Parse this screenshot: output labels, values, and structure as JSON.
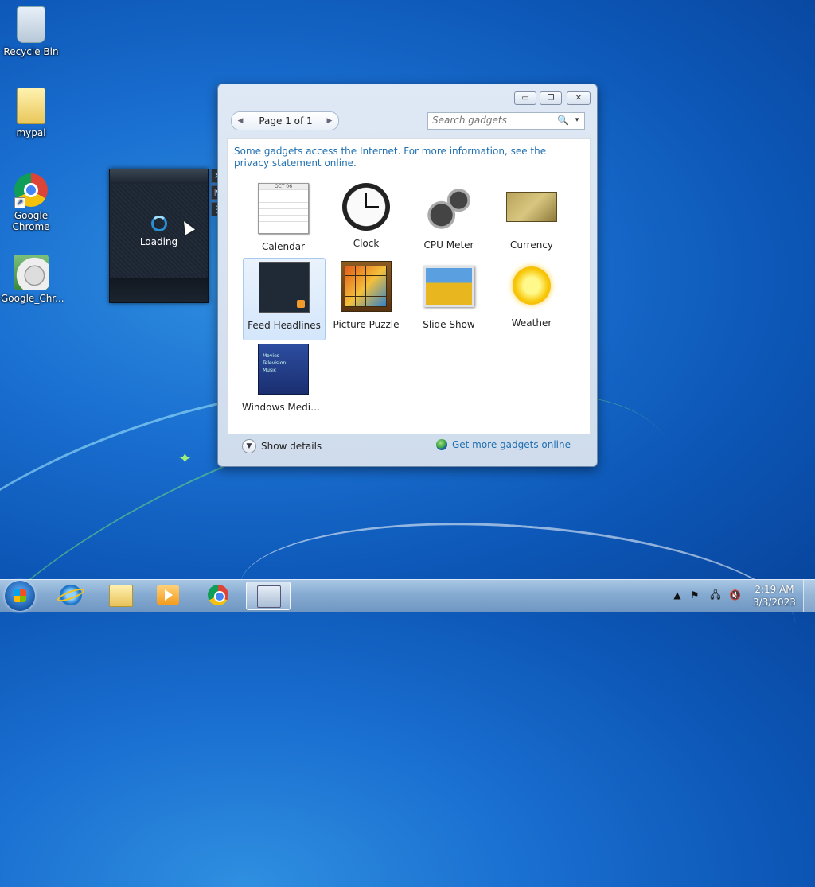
{
  "desktop": {
    "icons": [
      {
        "label": "Recycle Bin",
        "icon": "recycle-bin-icon"
      },
      {
        "label": "mypal",
        "icon": "folder-icon"
      },
      {
        "label": "Google Chrome",
        "icon": "chrome-icon"
      },
      {
        "label": "Google_Chr...",
        "icon": "installer-icon"
      }
    ]
  },
  "loading_gadget": {
    "text": "Loading",
    "tools": {
      "close": "✕",
      "resize": "⇱",
      "drag": "⋮⋮"
    }
  },
  "gallery": {
    "window_buttons": {
      "minimize": "▭",
      "restore": "❐",
      "close": "✕"
    },
    "pager": {
      "label": "Page 1 of 1",
      "prev": "◀",
      "next": "▶"
    },
    "search": {
      "placeholder": "Search gadgets",
      "icon": "🔍",
      "dropdown": "▾"
    },
    "privacy_notice": "Some gadgets access the Internet.  For more information, see the privacy statement online.",
    "gadgets": [
      {
        "label": "Calendar",
        "icon": "calendar-thumbnail",
        "calendar_header": "OCT 06"
      },
      {
        "label": "Clock",
        "icon": "clock-thumbnail"
      },
      {
        "label": "CPU Meter",
        "icon": "cpu-meter-thumbnail"
      },
      {
        "label": "Currency",
        "icon": "currency-thumbnail"
      },
      {
        "label": "Feed Headlines",
        "icon": "feed-headlines-thumbnail",
        "selected": true
      },
      {
        "label": "Picture Puzzle",
        "icon": "picture-puzzle-thumbnail"
      },
      {
        "label": "Slide Show",
        "icon": "slide-show-thumbnail"
      },
      {
        "label": "Weather",
        "icon": "weather-thumbnail"
      },
      {
        "label": "Windows Media...",
        "icon": "windows-media-center-thumbnail",
        "menu": [
          "Movies",
          "Television",
          "Music"
        ]
      }
    ],
    "show_details": "Show details",
    "get_more": "Get more gadgets online"
  },
  "taskbar": {
    "pinned": [
      {
        "name": "internet-explorer",
        "icon": "ie-icon"
      },
      {
        "name": "windows-explorer",
        "icon": "explorer-icon"
      },
      {
        "name": "windows-media-player",
        "icon": "media-player-icon"
      },
      {
        "name": "google-chrome",
        "icon": "chrome-icon"
      },
      {
        "name": "desktop-gadgets",
        "icon": "gadgets-icon",
        "active": true
      }
    ],
    "tray": {
      "show_hidden": "▲",
      "action_center": "⚑",
      "network": "🖧",
      "volume": "🔇"
    },
    "time": "2:19 AM",
    "date": "3/3/2023"
  }
}
